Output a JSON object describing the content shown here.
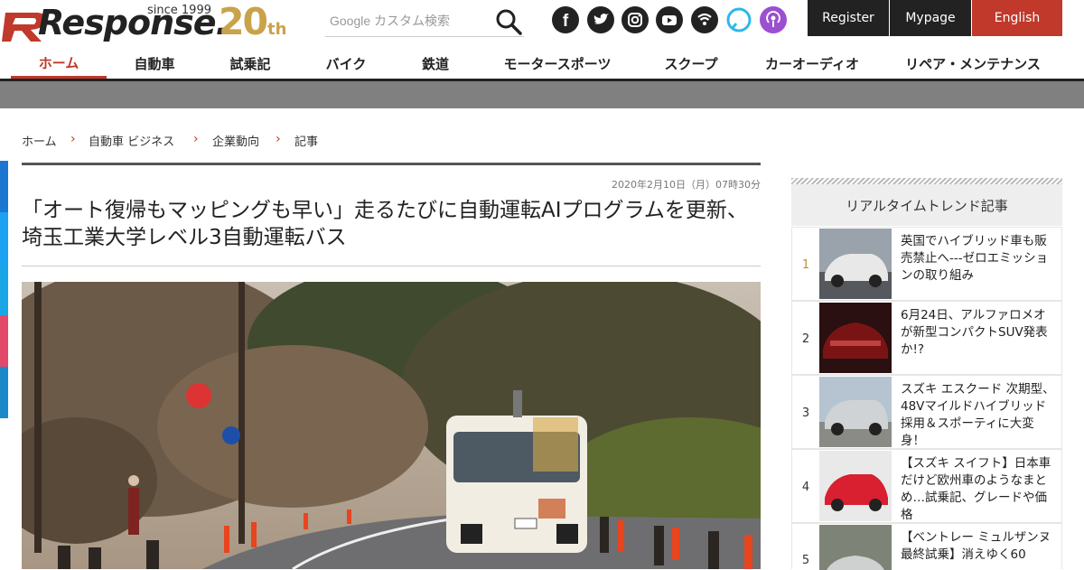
{
  "logo": {
    "text": "Response.",
    "since": "since 1999",
    "anniv_num": "20",
    "anniv_suffix": "th"
  },
  "search": {
    "placeholder": "Google カスタム検索"
  },
  "social_icons": [
    "facebook-icon",
    "twitter-icon",
    "instagram-icon",
    "youtube-icon",
    "rss-icon",
    "alexa-icon",
    "podcast-icon"
  ],
  "top_buttons": {
    "register": "Register",
    "mypage": "Mypage",
    "english": "English"
  },
  "nav": [
    "ホーム",
    "自動車",
    "試乗記",
    "バイク",
    "鉄道",
    "モータースポーツ",
    "スクープ",
    "カーオーディオ",
    "リペア・メンテナンス"
  ],
  "breadcrumb": [
    "ホーム",
    "自動車 ビジネス",
    "企業動向",
    "記事"
  ],
  "article": {
    "date": "2020年2月10日（月）07時30分",
    "title": "「オート復帰もマッピングも早い」走るたびに自動運転AIプログラムを更新、埼玉工業大学レベル3自動運転バス"
  },
  "sidebar": {
    "heading": "リアルタイムトレンド記事",
    "items": [
      {
        "rank": "1",
        "text": "英国でハイブリッド車も販売禁止へ---ゼロエミッションの取り組み"
      },
      {
        "rank": "2",
        "text": "6月24日、アルファロメオが新型コンパクトSUV発表か!?"
      },
      {
        "rank": "3",
        "text": "スズキ エスクード 次期型、48Vマイルドハイブリッド採用＆スポーティに大変身！"
      },
      {
        "rank": "4",
        "text": "【スズキ スイフト】日本車だけど欧州車のようなまとめ…試乗記、グレードや価格"
      },
      {
        "rank": "5",
        "text": "【ベントレー ミュルザンヌ 最終試乗】消えゆく60"
      }
    ]
  },
  "colors": {
    "accent": "#c0392b",
    "english_btn": "#c0392b",
    "dark_btn": "#222222",
    "gold": "#c9a34a"
  }
}
